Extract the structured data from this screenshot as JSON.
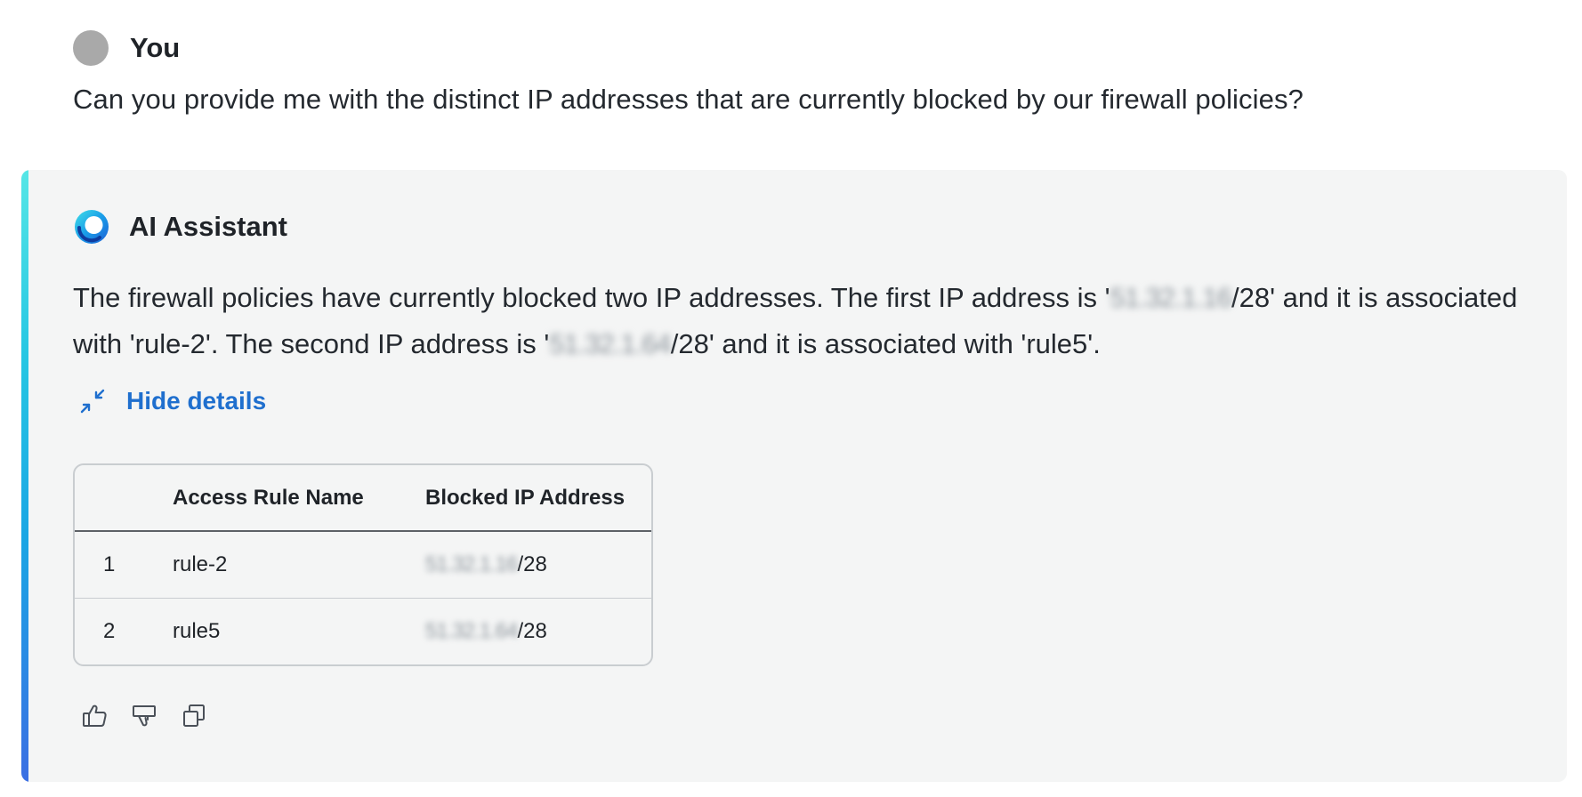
{
  "user": {
    "name": "You",
    "message": "Can you provide me with the distinct IP addresses that are currently blocked by our firewall policies?"
  },
  "assistant": {
    "name": "AI Assistant",
    "response": {
      "part1": "The firewall policies have currently blocked two IP addresses. The first IP address is '",
      "ip1_redacted": "51.32.1.16",
      "part2": "/28' and it is associated with 'rule-2'. The second IP address is '",
      "ip2_redacted": "51.32.1.64",
      "part3": "/28' and it is associated with 'rule5'."
    },
    "toggle_label": "Hide details",
    "table": {
      "columns": [
        "",
        "Access Rule Name",
        "Blocked IP Address"
      ],
      "rows": [
        {
          "index": "1",
          "rule": "rule-2",
          "ip_redacted": "51.32.1.16",
          "ip_suffix": "/28"
        },
        {
          "index": "2",
          "rule": "rule5",
          "ip_redacted": "51.32.1.64",
          "ip_suffix": "/28"
        }
      ]
    },
    "actions": [
      "thumbs-up-icon",
      "thumbs-down-icon",
      "copy-icon"
    ]
  },
  "colors": {
    "accent_link": "#1f6fce",
    "card_background": "#f4f5f5",
    "avatar": "#a9a9a9"
  }
}
